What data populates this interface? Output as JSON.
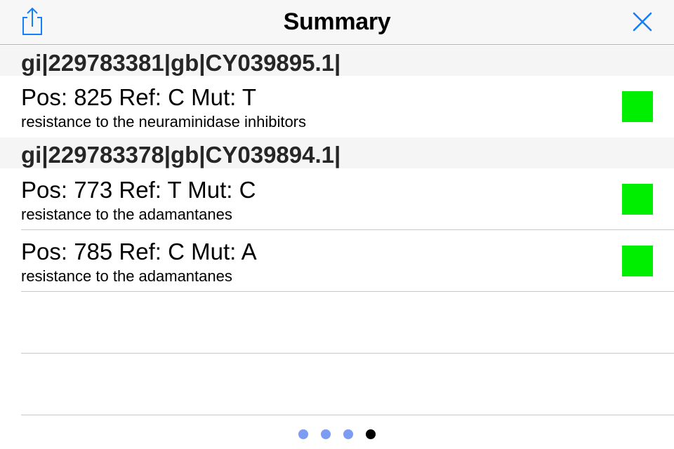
{
  "nav": {
    "title": "Summary",
    "share_icon": "share-icon",
    "close_icon": "close-icon",
    "accent_color": "#147efb"
  },
  "sections": [
    {
      "header": "gi|229783381|gb|CY039895.1|",
      "rows": [
        {
          "title": "Pos: 825 Ref: C Mut: T",
          "subtitle": "resistance to the neuraminidase inhibitors",
          "status_color": "#00ee00"
        }
      ]
    },
    {
      "header": "gi|229783378|gb|CY039894.1|",
      "rows": [
        {
          "title": "Pos: 773 Ref: T Mut: C",
          "subtitle": "resistance to the adamantanes",
          "status_color": "#00ee00"
        },
        {
          "title": "Pos: 785 Ref: C Mut: A",
          "subtitle": "resistance to the adamantanes",
          "status_color": "#00ee00"
        }
      ]
    }
  ],
  "page_control": {
    "count": 4,
    "current": 4,
    "inactive_color": "#7b9cf2",
    "active_color": "#000000"
  }
}
